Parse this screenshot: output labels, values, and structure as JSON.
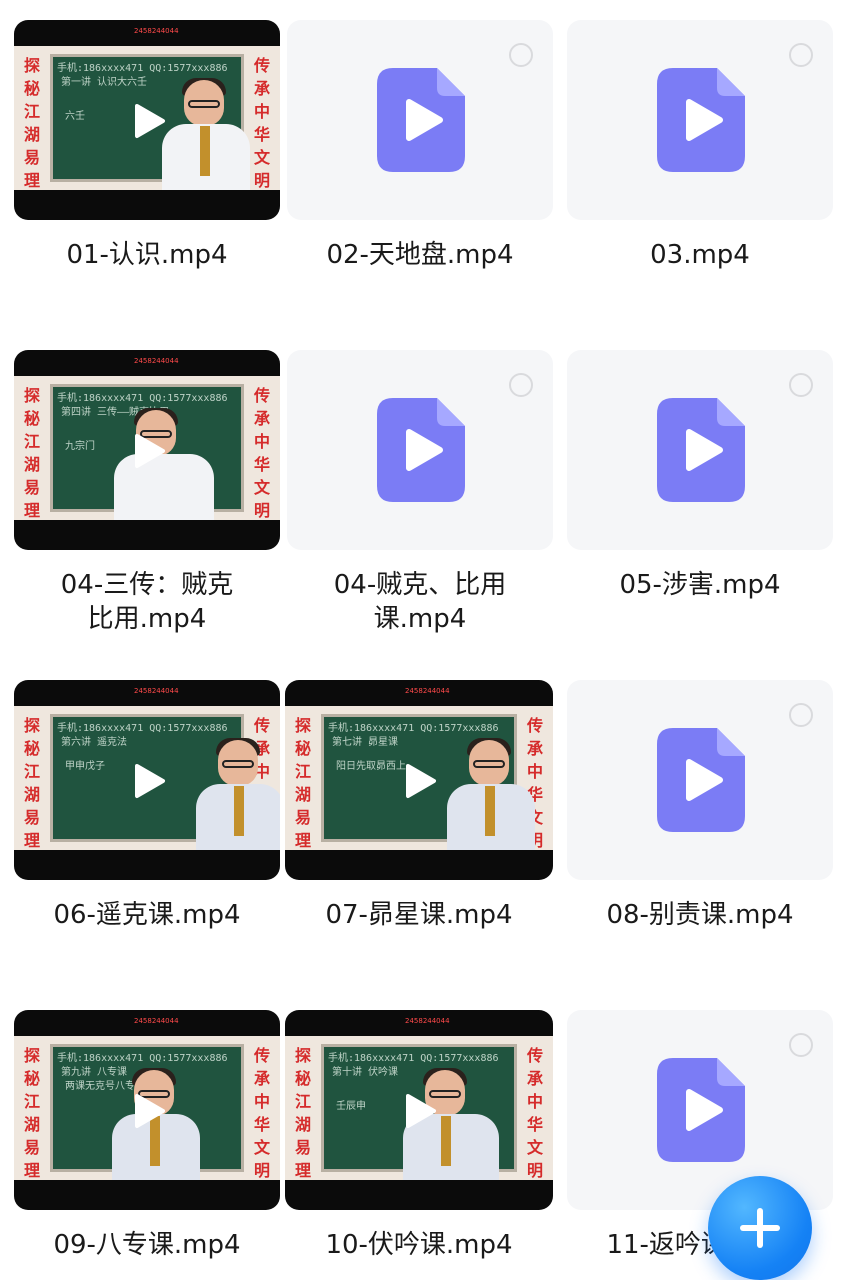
{
  "files": [
    {
      "name": "01-认识.mp4",
      "kind": "video",
      "side_left": "探秘江湖易理",
      "side_right": "传承中华文明",
      "board": [
        "手机:186xxxx471 QQ:1577xxx886",
        "第一讲 认识大六壬",
        "六壬"
      ],
      "strip": "2458244044"
    },
    {
      "name": "02-天地盘.mp4",
      "kind": "file"
    },
    {
      "name": "03.mp4",
      "kind": "file"
    },
    {
      "name": "04-三传：贼克比用.mp4",
      "kind": "video",
      "side_left": "探秘江湖易理",
      "side_right": "传承中华文明",
      "board": [
        "手机:186xxxx471 QQ:1577xxx886",
        "第四讲 三传——贼克比用",
        "九宗门"
      ],
      "strip": "2458244044"
    },
    {
      "name": "04-贼克、比用课.mp4",
      "kind": "file"
    },
    {
      "name": "05-涉害.mp4",
      "kind": "file"
    },
    {
      "name": "06-遥克课.mp4",
      "kind": "video",
      "side_left": "探秘江湖易理",
      "side_right": "传承中华文明",
      "board": [
        "手机:186xxxx471 QQ:1577xxx886",
        "第六讲 遥克法",
        "甲申戊子"
      ],
      "strip": "2458244044"
    },
    {
      "name": "07-昴星课.mp4",
      "kind": "video",
      "side_left": "探秘江湖易理",
      "side_right": "传承中华文明",
      "board": [
        "手机:186xxxx471 QQ:1577xxx886",
        "第七讲 昴星课",
        "阳日先取昴西上"
      ],
      "strip": "2458244044"
    },
    {
      "name": "08-别责课.mp4",
      "kind": "file"
    },
    {
      "name": "09-八专课.mp4",
      "kind": "video",
      "side_left": "探秘江湖易理",
      "side_right": "传承中华文明",
      "board": [
        "手机:186xxxx471 QQ:1577xxx886",
        "第九讲 八专课",
        "两课无克号八专"
      ],
      "strip": "2458244044"
    },
    {
      "name": "10-伏吟课.mp4",
      "kind": "video",
      "side_left": "探秘江湖易理",
      "side_right": "传承中华文明",
      "board": [
        "手机:186xxxx471 QQ:1577xxx886",
        "第十讲 伏吟课",
        "壬辰申"
      ],
      "strip": "2458244044"
    },
    {
      "name": "11-返吟课.mp4",
      "kind": "file"
    }
  ],
  "fab": {
    "icon": "plus-icon",
    "color": "#1582f5"
  },
  "colors": {
    "file_icon": "#7b7cf5",
    "tile_bg": "#f5f6f8",
    "side_text": "#d52b2b"
  }
}
